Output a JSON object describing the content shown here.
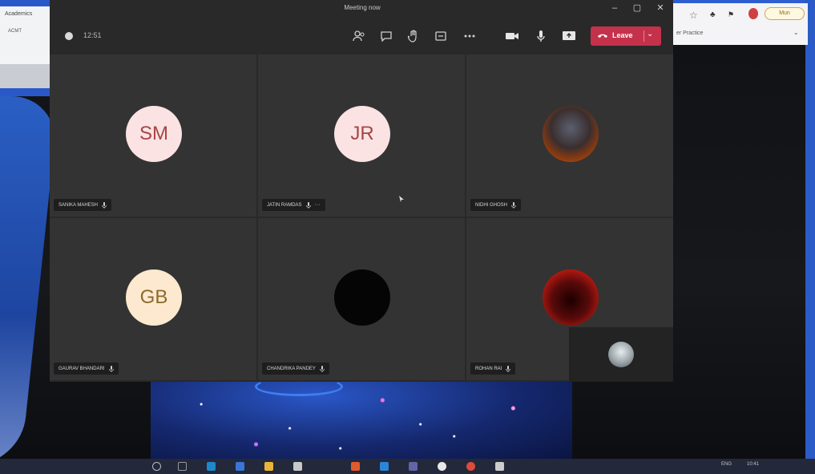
{
  "window": {
    "title": "Meeting now"
  },
  "toolbar": {
    "time": "12:51",
    "leave_label": "Leave"
  },
  "participants": [
    {
      "initials": "SM",
      "name": "SANIKA MAHESH"
    },
    {
      "initials": "JR",
      "name": "JATIN RAMDAS"
    },
    {
      "initials": "",
      "name": "NIDHI GHOSH"
    },
    {
      "initials": "GB",
      "name": "GAURAV BHANDARI"
    },
    {
      "initials": "",
      "name": "CHANDRIKA PANDEY"
    },
    {
      "initials": "",
      "name": "ROHAN RAI"
    }
  ],
  "browser": {
    "tab_text": "Academics",
    "address_text": "ACMT",
    "profile_pill": "Mun",
    "page_text": "er Practice"
  },
  "taskbar": {
    "lang": "ENG",
    "clock": "10:41"
  },
  "colors": {
    "leave": "#c4314b",
    "window_bg": "#292929",
    "tile_bg": "#333333",
    "desktop_accent": "#2e5fd0"
  }
}
